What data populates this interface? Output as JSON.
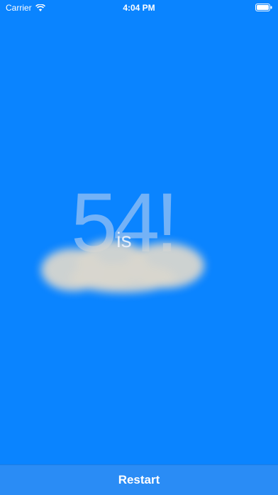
{
  "status_bar": {
    "carrier": "Carrier",
    "time": "4:04 PM",
    "wifi_icon": "wifi-icon",
    "battery_icon": "battery-icon"
  },
  "hero": {
    "number": "54!",
    "word": "is"
  },
  "footer": {
    "restart_label": "Restart"
  },
  "colors": {
    "background": "#0a84ff",
    "button": "#2a8cf5"
  }
}
